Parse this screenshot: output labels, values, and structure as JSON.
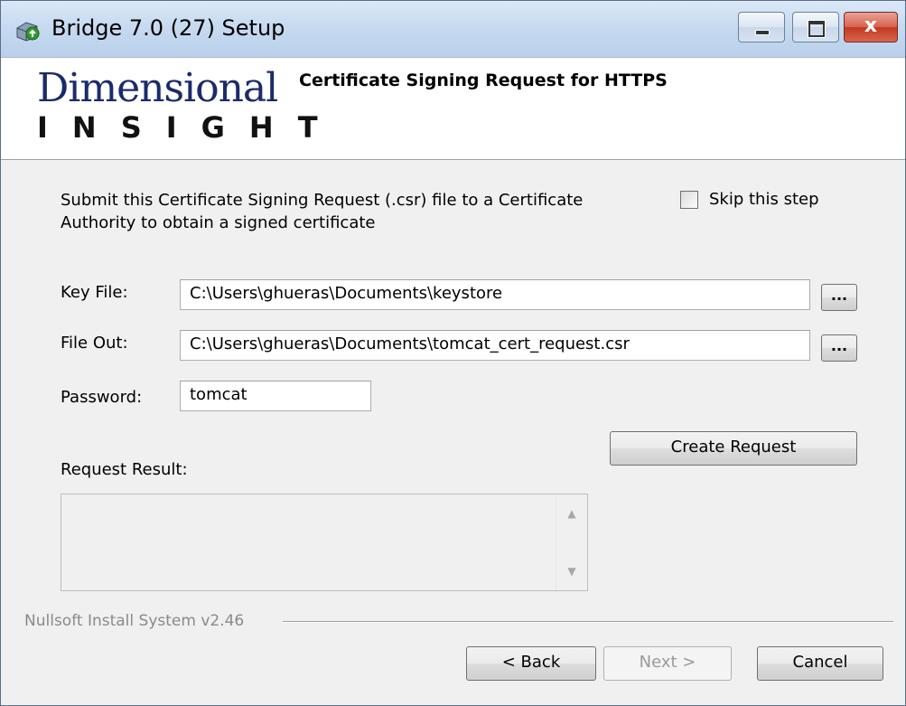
{
  "window": {
    "title": "Bridge 7.0 (27) Setup",
    "close_label": "x"
  },
  "header": {
    "logo_line1": "Dimensional",
    "logo_line2": "INSIGHT",
    "title": "Certificate Signing Request for HTTPS"
  },
  "body": {
    "description": "Submit this Certificate Signing Request (.csr) file to a Certificate Authority to obtain a signed certificate",
    "skip_label": "Skip this step",
    "skip_checked": false,
    "key_file_label": "Key File:",
    "key_file_value": "C:\\Users\\ghueras\\Documents\\keystore",
    "file_out_label": "File Out:",
    "file_out_value": "C:\\Users\\ghueras\\Documents\\tomcat_cert_request.csr",
    "password_label": "Password:",
    "password_value": "tomcat",
    "browse_label": "...",
    "create_request_label": "Create Request",
    "request_result_label": "Request Result:",
    "request_result_value": ""
  },
  "footer": {
    "nsis_text": "Nullsoft Install System v2.46",
    "back_label": "< Back",
    "next_label": "Next >",
    "cancel_label": "Cancel"
  },
  "colors": {
    "title_bar": "#c7daf0",
    "close_button": "#c2371f",
    "logo_blue": "#1b2b6a"
  }
}
